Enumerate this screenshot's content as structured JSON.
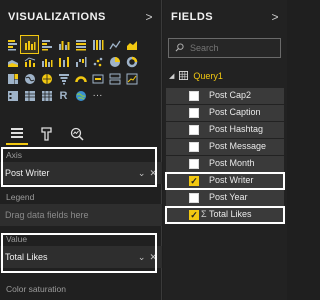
{
  "viz_panel": {
    "title": "VISUALIZATIONS",
    "chevron": ">",
    "visual_icons": [
      [
        "stacked-bar-icon",
        "stacked-column-icon",
        "clustered-bar-icon",
        "clustered-column-icon",
        "100-bar-icon",
        "100-column-icon",
        "line-chart-icon",
        "area-chart-icon"
      ],
      [
        "stacked-area-icon",
        "line-column-icon",
        "line-clustered-column-icon",
        "ribbon-icon",
        "waterfall-icon",
        "scatter-icon",
        "pie-icon",
        "donut-icon"
      ],
      [
        "treemap-icon",
        "map-icon",
        "filled-map-icon",
        "funnel-icon",
        "gauge-icon",
        "card-icon",
        "multirow-card-icon",
        "kpi-icon"
      ],
      [
        "slicer-icon",
        "table-icon",
        "matrix-icon",
        "r-visual-icon",
        "globe-icon",
        "more-icon"
      ]
    ],
    "more_glyph": "···",
    "r_glyph": "R",
    "selected_icon": "stacked-column-icon",
    "tool_tabs": [
      "fields-tab-icon",
      "format-tab-icon",
      "analytics-tab-icon"
    ],
    "wells": {
      "axis": {
        "label": "Axis",
        "value": "Post Writer"
      },
      "legend": {
        "label": "Legend",
        "placeholder": "Drag data fields here"
      },
      "value": {
        "label": "Value",
        "value": "Total Likes"
      },
      "color_saturation": {
        "label": "Color saturation"
      }
    },
    "dropdown_glyph": "⌄",
    "remove_glyph": "✕"
  },
  "fields_panel": {
    "title": "FIELDS",
    "chevron": ">",
    "search_placeholder": "Search",
    "table": {
      "name": "Query1",
      "expand_glyph": "◢"
    },
    "fields": [
      {
        "label": "Post Cap2",
        "checked": false
      },
      {
        "label": "Post Caption",
        "checked": false
      },
      {
        "label": "Post Hashtag",
        "checked": false
      },
      {
        "label": "Post Message",
        "checked": false
      },
      {
        "label": "Post Month",
        "checked": false
      },
      {
        "label": "Post Writer",
        "checked": true
      },
      {
        "label": "Post Year",
        "checked": false
      },
      {
        "label": "Total Likes",
        "checked": true,
        "sigma": "Σ"
      }
    ],
    "check_glyph": "✓"
  },
  "colors": {
    "accent": "#f2c811",
    "highlight_frame": "#ffffff",
    "panel_bg": "#202020",
    "field_bg": "#3a3a3a"
  }
}
